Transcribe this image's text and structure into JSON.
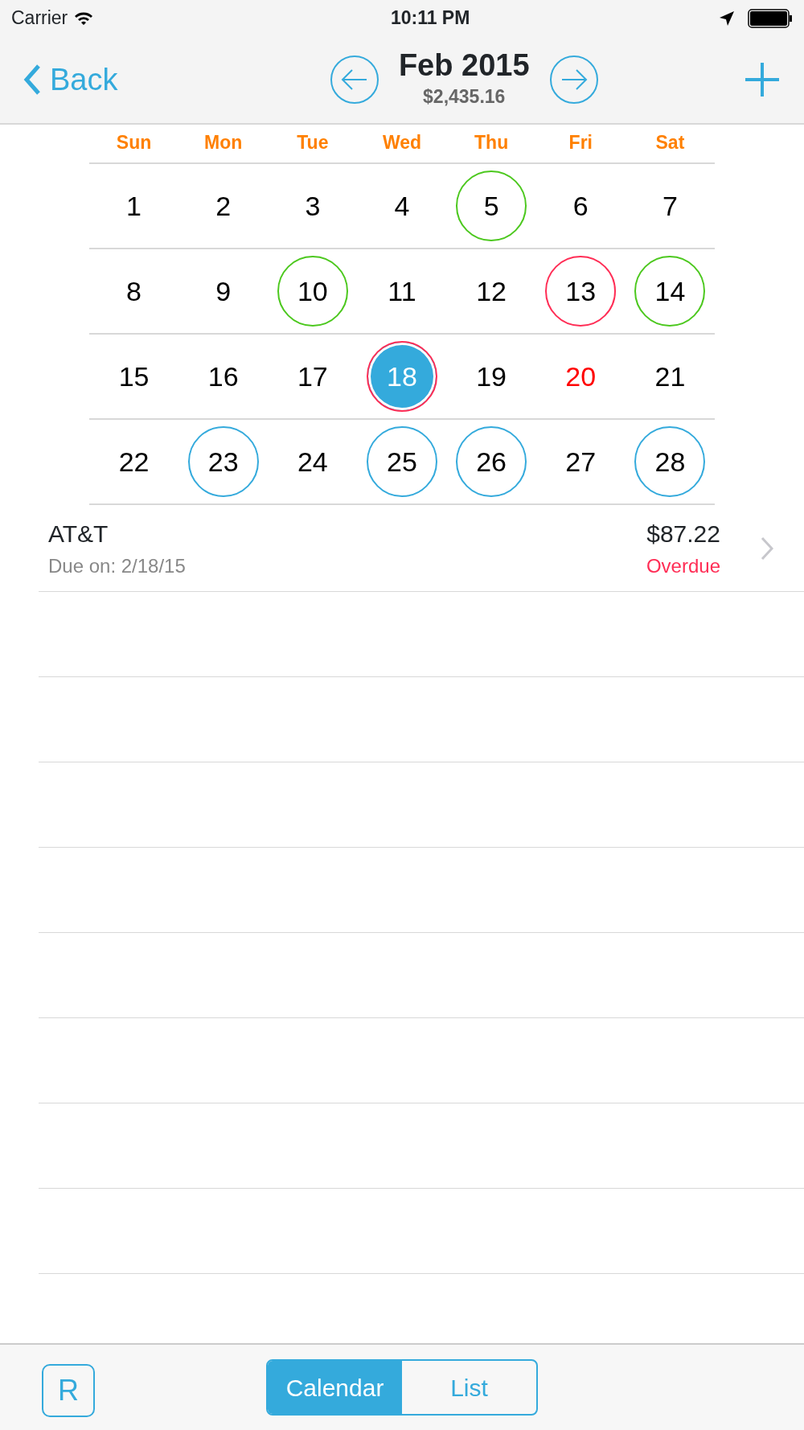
{
  "status_bar": {
    "carrier": "Carrier",
    "time": "10:11 PM"
  },
  "nav": {
    "back": "Back",
    "title": "Feb 2015",
    "total": "$2,435.16"
  },
  "calendar": {
    "weekdays": [
      "Sun",
      "Mon",
      "Tue",
      "Wed",
      "Thu",
      "Fri",
      "Sat"
    ],
    "weeks": [
      [
        {
          "label": "1",
          "selected": false,
          "today": false
        },
        {
          "label": "2",
          "selected": false,
          "today": false
        },
        {
          "label": "3",
          "selected": false,
          "today": false
        },
        {
          "label": "4",
          "selected": false,
          "today": false
        },
        {
          "label": "5",
          "selected": false,
          "today": false,
          "color": "#4cc81e"
        },
        {
          "label": "6",
          "selected": false,
          "today": false
        },
        {
          "label": "7",
          "selected": false,
          "today": false
        }
      ],
      [
        {
          "label": "8",
          "selected": false,
          "today": false
        },
        {
          "label": "9",
          "selected": false,
          "today": false
        },
        {
          "label": "10",
          "selected": false,
          "today": false,
          "color": "#4cc81e"
        },
        {
          "label": "11",
          "selected": false,
          "today": false
        },
        {
          "label": "12",
          "selected": false,
          "today": false
        },
        {
          "label": "13",
          "selected": false,
          "today": false,
          "color": "#ff2d55"
        },
        {
          "label": "14",
          "selected": false,
          "today": false,
          "color": "#4cc81e"
        }
      ],
      [
        {
          "label": "15",
          "selected": false,
          "today": false
        },
        {
          "label": "16",
          "selected": false,
          "today": false
        },
        {
          "label": "17",
          "selected": false,
          "today": false
        },
        {
          "label": "18",
          "selected": true,
          "today": false,
          "color": "#ff2d55"
        },
        {
          "label": "19",
          "selected": false,
          "today": false
        },
        {
          "label": "20",
          "selected": false,
          "today": true
        },
        {
          "label": "21",
          "selected": false,
          "today": false
        }
      ],
      [
        {
          "label": "22",
          "selected": false,
          "today": false
        },
        {
          "label": "23",
          "selected": false,
          "today": false,
          "color": "#34aadc"
        },
        {
          "label": "24",
          "selected": false,
          "today": false
        },
        {
          "label": "25",
          "selected": false,
          "today": false,
          "color": "#34aadc"
        },
        {
          "label": "26",
          "selected": false,
          "today": false,
          "color": "#34aadc"
        },
        {
          "label": "27",
          "selected": false,
          "today": false
        },
        {
          "label": "28",
          "selected": false,
          "today": false,
          "color": "#34aadc"
        }
      ]
    ]
  },
  "bills": [
    {
      "name": "AT&T",
      "due": "Due on: 2/18/15",
      "amount": "$87.22",
      "status": "Overdue",
      "overdue": true
    }
  ],
  "tab_bar": {
    "r_button": "R",
    "segments": [
      {
        "label": "Calendar",
        "selected": true
      },
      {
        "label": "List",
        "selected": false
      }
    ]
  }
}
